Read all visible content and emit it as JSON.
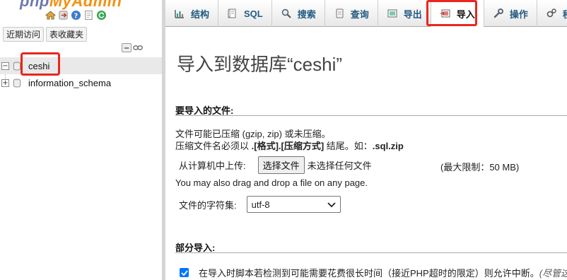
{
  "logo": {
    "text_main": "php",
    "text_accent": "MyAdmin"
  },
  "nav": {
    "icons": [
      "home-icon",
      "exit-icon",
      "help-icon",
      "docs-icon",
      "reload-icon"
    ],
    "recent_button": "近期访问",
    "favorites_button": "表收藏夹",
    "databases": [
      {
        "name": "ceshi",
        "selected": true
      },
      {
        "name": "information_schema",
        "selected": false
      }
    ]
  },
  "tabs": [
    {
      "label": "结构",
      "icon": "structure-icon"
    },
    {
      "label": "SQL",
      "icon": "sql-icon"
    },
    {
      "label": "搜索",
      "icon": "search-icon"
    },
    {
      "label": "查询",
      "icon": "query-icon"
    },
    {
      "label": "导出",
      "icon": "export-icon"
    },
    {
      "label": "导入",
      "icon": "import-icon",
      "active": true
    },
    {
      "label": "操作",
      "icon": "wrench-icon"
    },
    {
      "label": "程",
      "icon": "routines-icon"
    }
  ],
  "main": {
    "title": "导入到数据库“ceshi”",
    "file_section": {
      "heading": "要导入的文件:",
      "line1": "文件可能已压缩 (gzip, zip) 或未压缩。",
      "line2_pre": "压缩文件名必须以 ",
      "line2_bold": ".[格式].[压缩方式]",
      "line2_mid": " 结尾。如：",
      "line2_bold2": ".sql.zip",
      "upload_label": "从计算机中上传:",
      "choose_button": "选择文件",
      "no_file": "未选择任何文件",
      "max_size": "(最大限制：50 MB)",
      "drag_hint": "You may also drag and drop a file on any page.",
      "charset_label": "文件的字符集:",
      "charset_value": "utf-8"
    },
    "partial_section": {
      "heading": "部分导入:",
      "checked": true,
      "allow_interrupt": "在导入时脚本若检测到可能需要花费很长时间（接近PHP超时的限定）则允许中断。",
      "note": "(尽管这"
    }
  },
  "colors": {
    "highlight": "#e8271f",
    "link": "#235a81",
    "checkbox": "#0075ff"
  }
}
